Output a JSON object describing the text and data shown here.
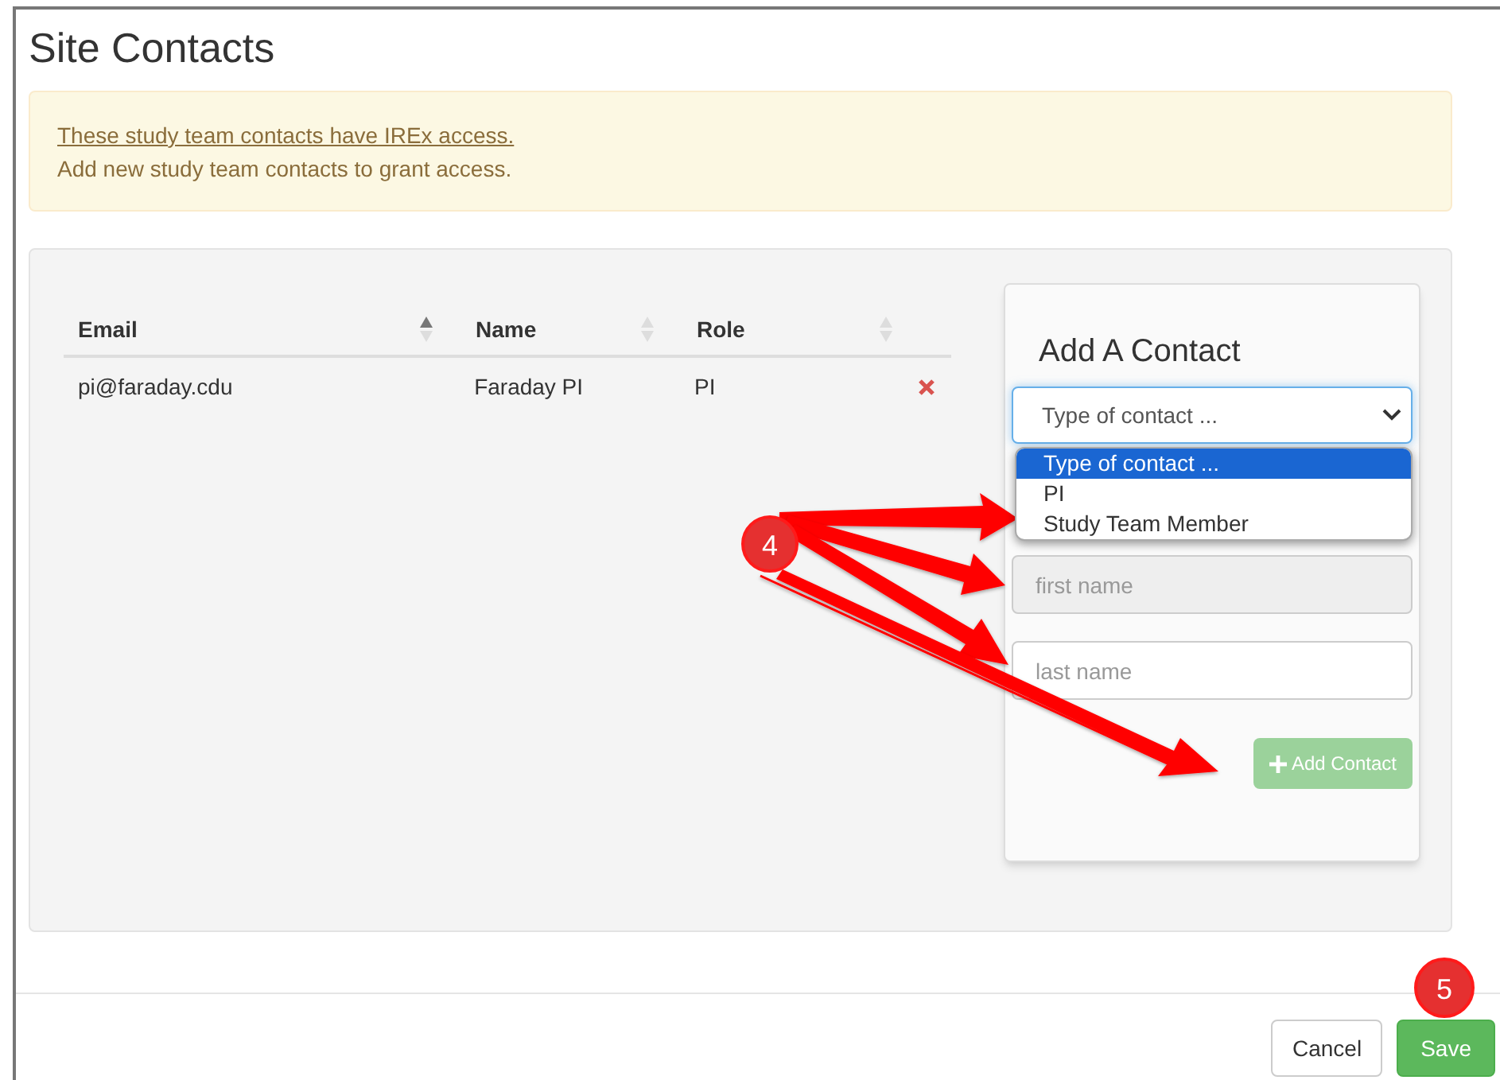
{
  "title": "Site Contacts",
  "alert": {
    "link": "These study team contacts have IREx access.",
    "text": "Add new study team contacts to grant access."
  },
  "table": {
    "columns": [
      {
        "label": "Email",
        "sorted": true
      },
      {
        "label": "Name",
        "sorted": false
      },
      {
        "label": "Role",
        "sorted": false
      }
    ],
    "rows": [
      {
        "cells": [
          "pi@faraday.cdu",
          "Faraday PI",
          "PI"
        ]
      }
    ]
  },
  "add_contact": {
    "heading": "Add A Contact",
    "type_select": {
      "value": "Type of contact ...",
      "expanded": true,
      "options": [
        {
          "label": "Type of contact ...",
          "selected": true
        },
        {
          "label": "PI",
          "selected": false
        },
        {
          "label": "Study Team Member",
          "selected": false
        }
      ]
    },
    "first_name": {
      "placeholder": "first name",
      "disabled": true
    },
    "last_name": {
      "placeholder": "last name",
      "disabled": false
    },
    "button": {
      "label": "Add Contact",
      "disabled": true
    }
  },
  "annotations": [
    {
      "label": "4"
    },
    {
      "label": "5"
    }
  ],
  "footer": {
    "buttons": [
      {
        "label": "Cancel",
        "kind": "default"
      },
      {
        "label": "Save",
        "kind": "primary"
      }
    ]
  }
}
